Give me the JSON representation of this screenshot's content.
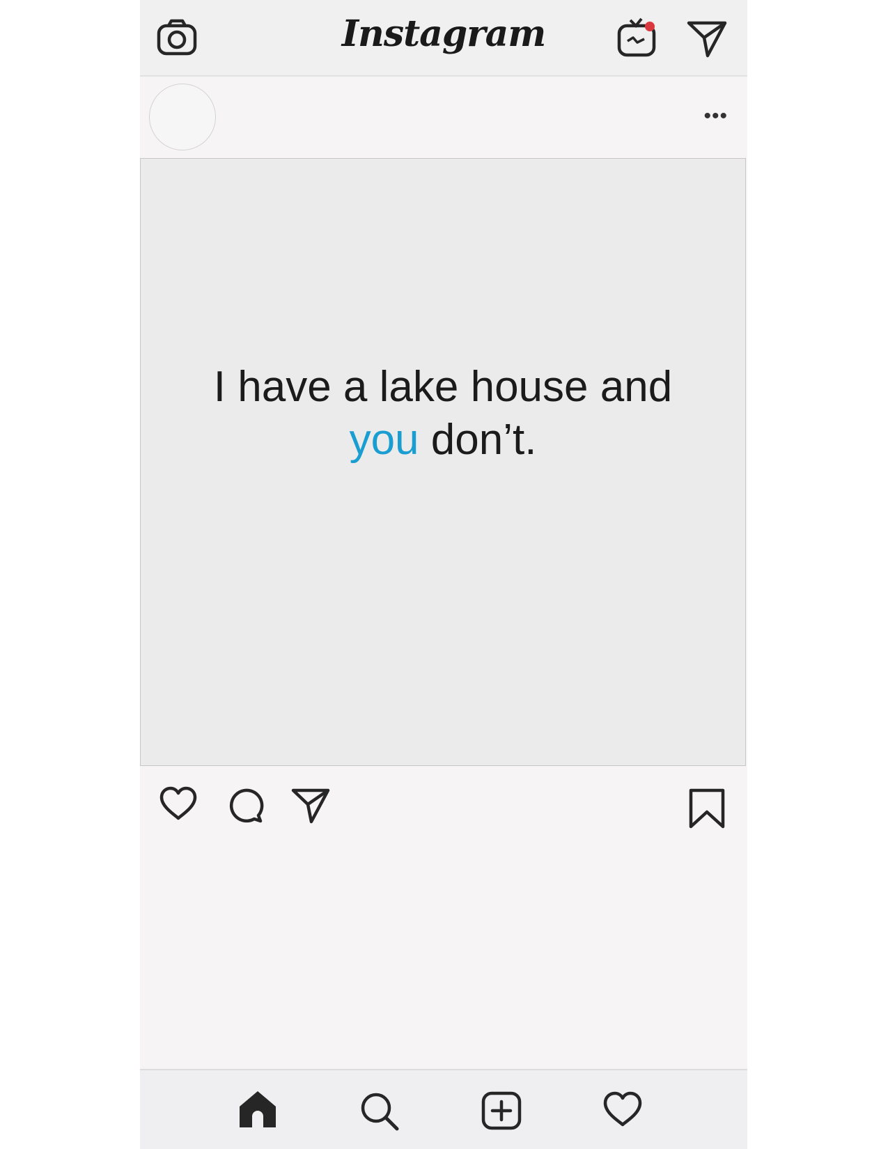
{
  "app": {
    "logo_text": "Instagram"
  },
  "header": {
    "icons": [
      "camera-icon",
      "igtv-icon",
      "direct-message-icon"
    ],
    "notification_dot_color": "#d9383f"
  },
  "post": {
    "more_label": "•••",
    "text_line1": "I have a lake house and",
    "text_accent": "you",
    "text_rest": " don’t.",
    "accent_color": "#1a9dd0"
  },
  "actions": {
    "icons": [
      "heart-icon",
      "comment-icon",
      "share-icon",
      "bookmark-icon"
    ]
  },
  "bottom_nav": {
    "icons": [
      "home-icon",
      "search-icon",
      "new-post-icon",
      "activity-heart-icon"
    ]
  }
}
